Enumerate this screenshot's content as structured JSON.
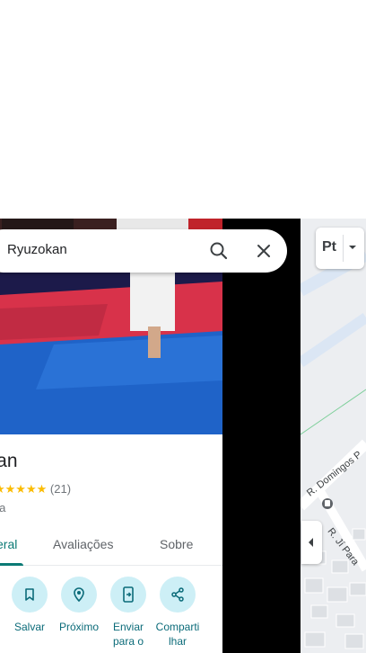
{
  "search": {
    "value": "Ryuzokan"
  },
  "place": {
    "title": "okan",
    "rating_count": "(21)",
    "stars": "★★★★★",
    "category": "nia"
  },
  "tabs": [
    {
      "label": "eral",
      "active": true
    },
    {
      "label": "Avaliações",
      "active": false
    },
    {
      "label": "Sobre",
      "active": false
    }
  ],
  "actions": [
    {
      "label": "Salvar",
      "icon": "bookmark-icon"
    },
    {
      "label": "Próximo",
      "icon": "nearby-icon"
    },
    {
      "label": "Enviar para o",
      "icon": "send-to-phone-icon"
    },
    {
      "label": "Comparti lhar",
      "icon": "share-icon"
    }
  ],
  "map": {
    "layer_label": "Pt",
    "streets": [
      "R. Domingos P",
      "R. Jí Para"
    ]
  },
  "colors": {
    "accent": "#0b7a75",
    "action_bg": "#cdeff6",
    "star": "#fbbc04"
  }
}
